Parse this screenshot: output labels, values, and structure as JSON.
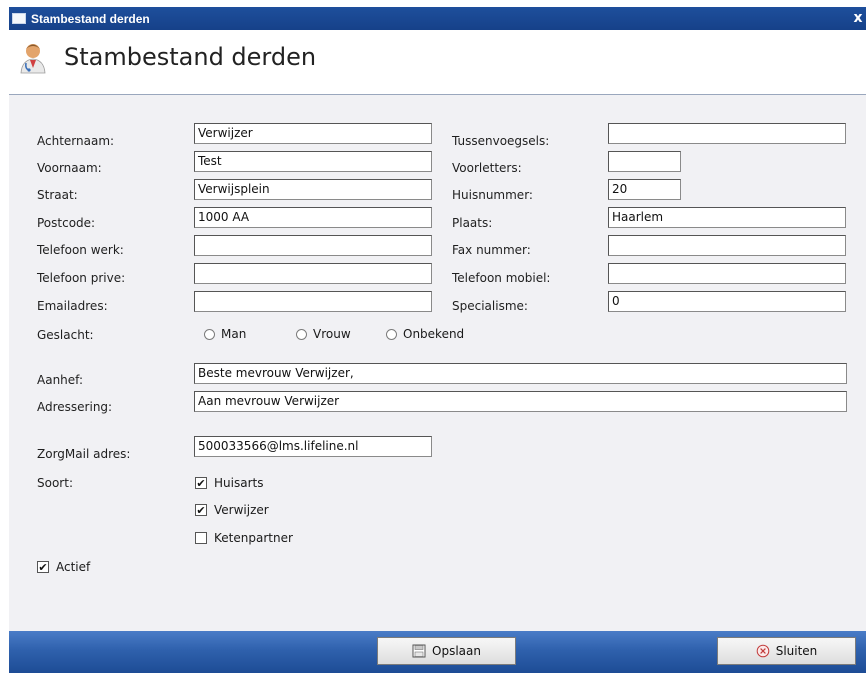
{
  "window": {
    "title": "Stambestand derden",
    "close": "x"
  },
  "header": {
    "title": "Stambestand derden"
  },
  "labels": {
    "achternaam": "Achternaam:",
    "voornaam": "Voornaam:",
    "straat": "Straat:",
    "postcode": "Postcode:",
    "telefoon_werk": "Telefoon werk:",
    "telefoon_prive": "Telefoon prive:",
    "emailadres": "Emailadres:",
    "geslacht": "Geslacht:",
    "tussenvoegsels": "Tussenvoegsels:",
    "voorletters": "Voorletters:",
    "huisnummer": "Huisnummer:",
    "plaats": "Plaats:",
    "fax_nummer": "Fax nummer:",
    "telefoon_mobiel": "Telefoon mobiel:",
    "specialisme": "Specialisme:",
    "aanhef": "Aanhef:",
    "adressering": "Adressering:",
    "zorgmail": "ZorgMail adres:",
    "soort": "Soort:"
  },
  "fields": {
    "achternaam": "Verwijzer",
    "voornaam": "Test",
    "straat": "Verwijsplein",
    "postcode": "1000 AA",
    "telefoon_werk": "",
    "telefoon_prive": "",
    "emailadres": "",
    "tussenvoegsels": "",
    "voorletters": "",
    "huisnummer": "20",
    "plaats": "Haarlem",
    "fax_nummer": "",
    "telefoon_mobiel": "",
    "specialisme": "0",
    "aanhef": "Beste mevrouw Verwijzer,",
    "adressering": "Aan mevrouw Verwijzer",
    "zorgmail": "500033566@lms.lifeline.nl"
  },
  "geslacht_options": {
    "man": "Man",
    "vrouw": "Vrouw",
    "onbekend": "Onbekend"
  },
  "soort": {
    "huisarts": {
      "label": "Huisarts",
      "mark": "✔"
    },
    "verwijzer": {
      "label": "Verwijzer",
      "mark": "✔"
    },
    "ketenpartner": {
      "label": "Ketenpartner",
      "mark": ""
    }
  },
  "actief": {
    "label": "Actief",
    "mark": "✔"
  },
  "buttons": {
    "opslaan": "Opslaan",
    "sluiten": "Sluiten"
  }
}
